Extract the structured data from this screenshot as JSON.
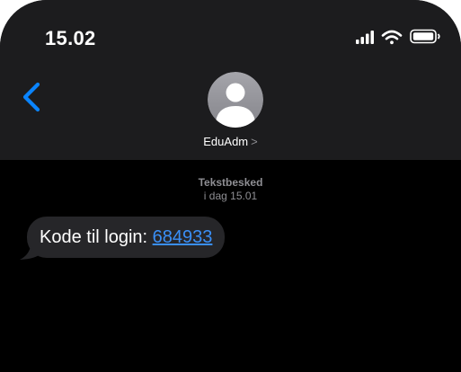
{
  "status_bar": {
    "time": "15.02",
    "icons": [
      "cellular-signal-icon",
      "wifi-icon",
      "battery-icon"
    ]
  },
  "header": {
    "contact_name": "EduAdm",
    "chevron": ">",
    "avatar_icon": "person-silhouette-icon",
    "back_icon": "chevron-left-icon"
  },
  "thread": {
    "service_label": "Tekstbesked",
    "date_label": "i dag 15.01"
  },
  "message": {
    "text": "Kode til login: ",
    "code": "684933"
  },
  "colors": {
    "accent": "#0a84ff",
    "link": "#3a8ff7",
    "header_bg": "#1c1c1e",
    "bubble_bg": "#262629",
    "background": "#000000",
    "secondary_text": "#8e8e93"
  }
}
